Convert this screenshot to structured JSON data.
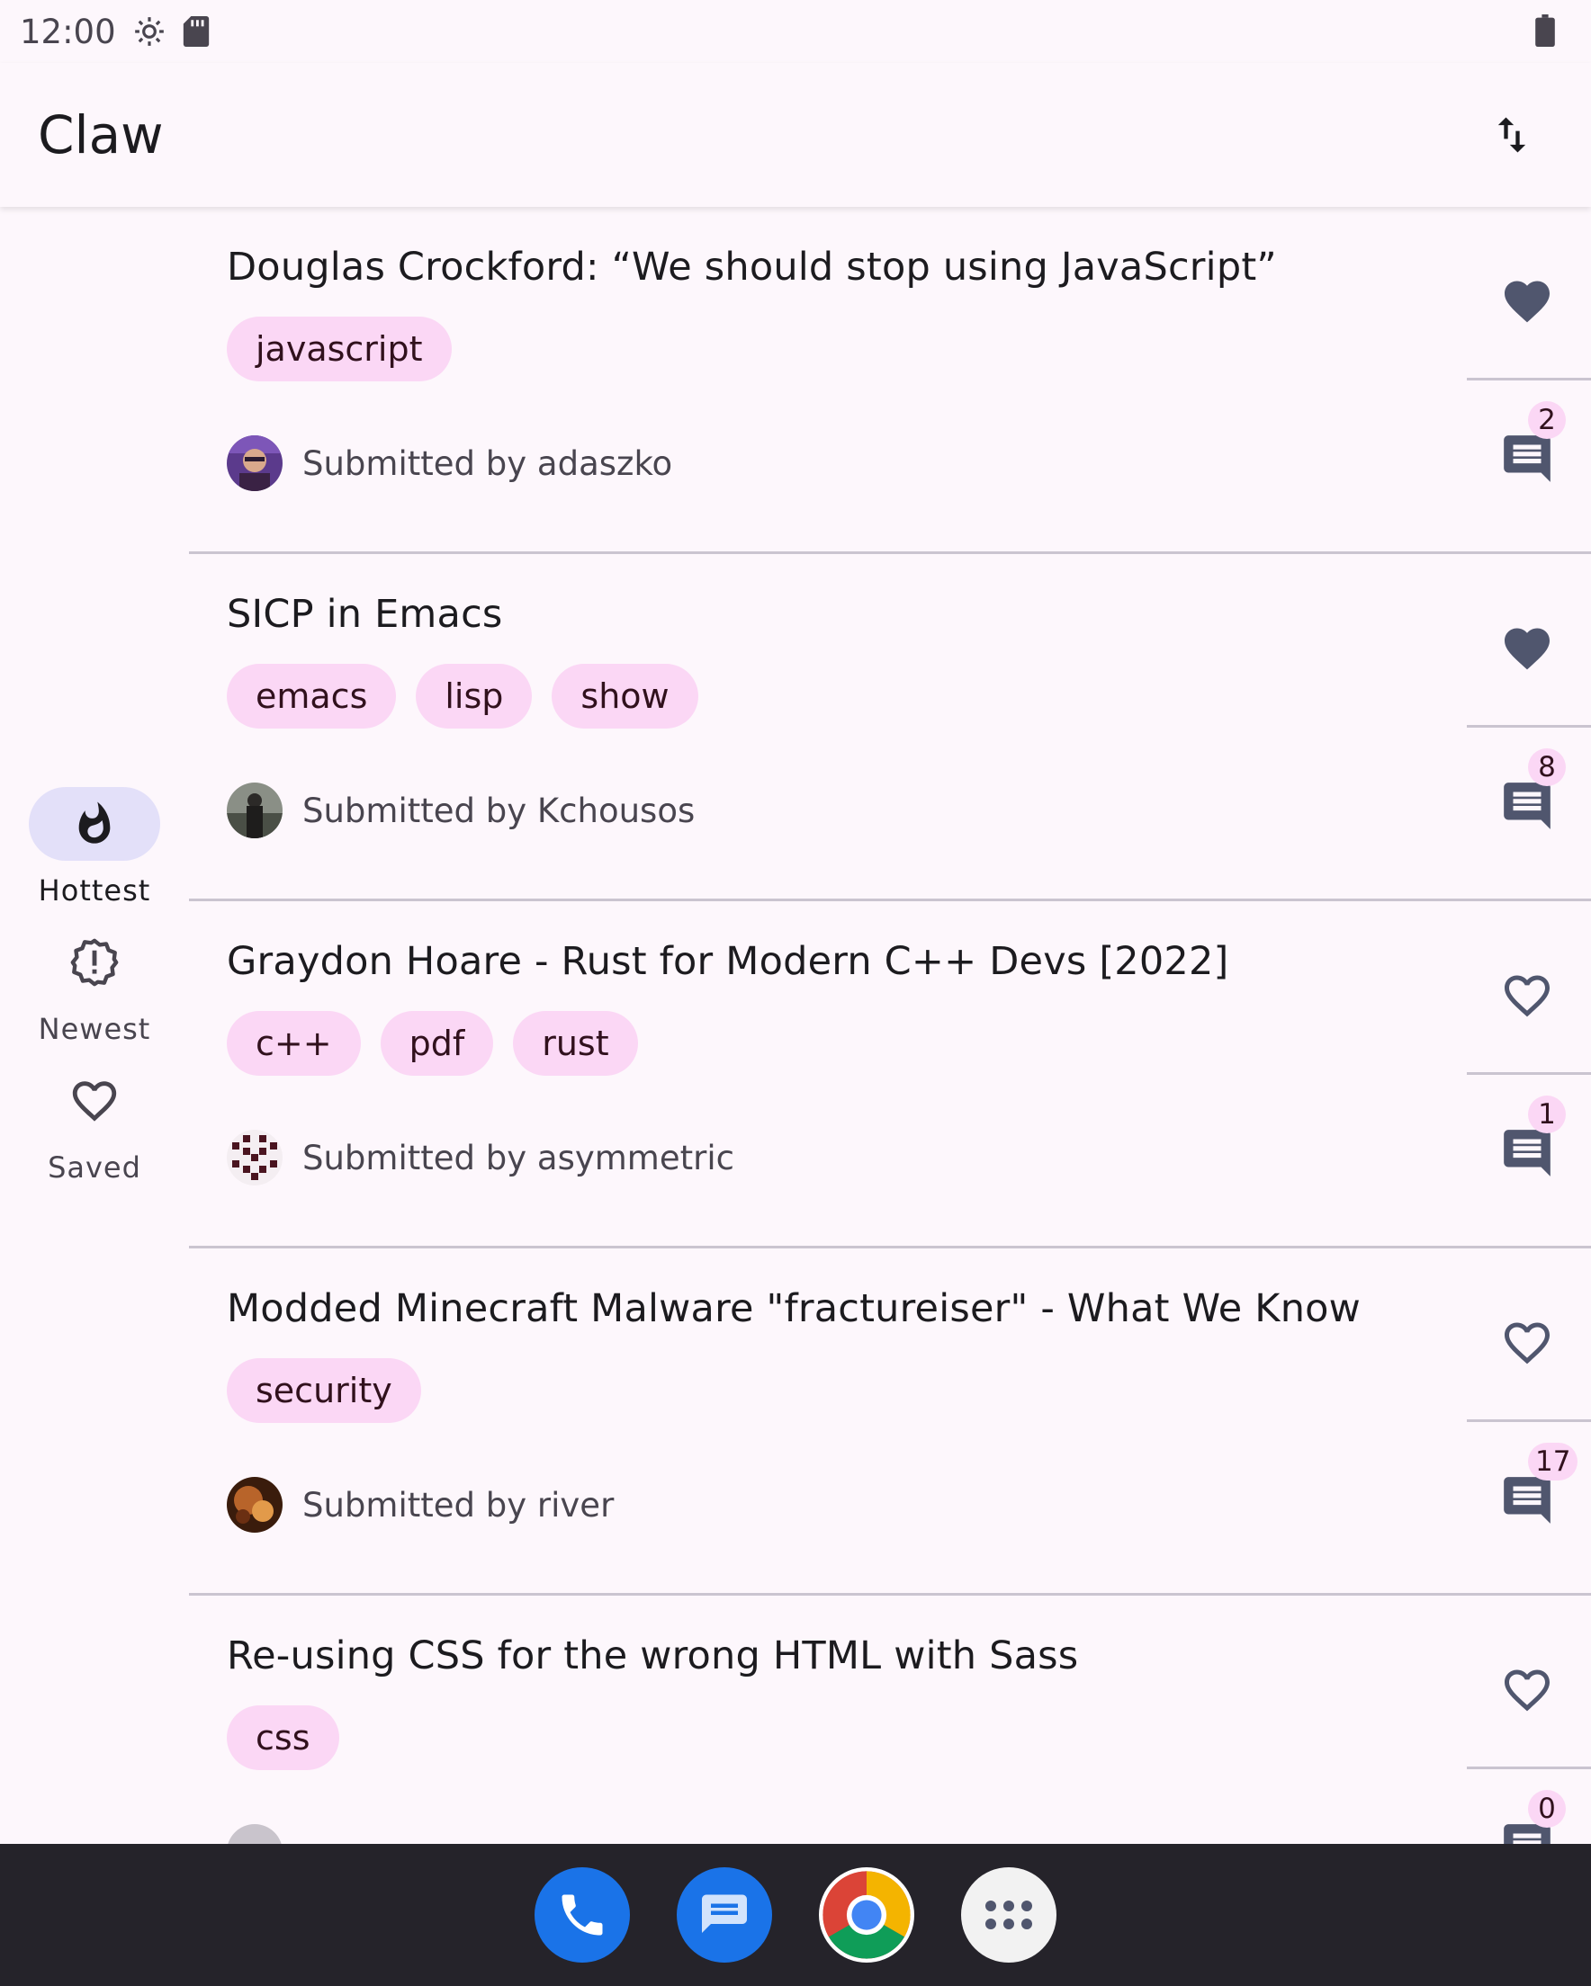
{
  "status_bar": {
    "time": "12:00",
    "icons": [
      "settings-icon",
      "sd-card-icon",
      "battery-icon"
    ]
  },
  "app_bar": {
    "title": "Claw",
    "sort_icon": "swap-vert-icon"
  },
  "nav_rail": {
    "items": [
      {
        "label": "Hottest",
        "icon": "flame-icon",
        "active": true
      },
      {
        "label": "Newest",
        "icon": "new-releases-icon",
        "active": false
      },
      {
        "label": "Saved",
        "icon": "heart-outline-icon",
        "active": false
      }
    ]
  },
  "stories": [
    {
      "title": "Douglas Crockford: “We should stop using JavaScript”",
      "tags": [
        "javascript"
      ],
      "submitted": "Submitted by adaszko",
      "saved": true,
      "comments": "2"
    },
    {
      "title": "SICP in Emacs",
      "tags": [
        "emacs",
        "lisp",
        "show"
      ],
      "submitted": "Submitted by Kchousos",
      "saved": true,
      "comments": "8"
    },
    {
      "title": "Graydon Hoare - Rust for Modern C++ Devs [2022]",
      "tags": [
        "c++",
        "pdf",
        "rust"
      ],
      "submitted": "Submitted by asymmetric",
      "saved": false,
      "comments": "1"
    },
    {
      "title": "Modded Minecraft Malware \"fractureiser\" - What We Know",
      "tags": [
        "security"
      ],
      "submitted": "Submitted by river",
      "saved": false,
      "comments": "17"
    },
    {
      "title": "Re-using CSS for the wrong HTML with Sass",
      "tags": [
        "css"
      ],
      "submitted": "",
      "saved": false,
      "comments": "0"
    }
  ],
  "dock": {
    "apps": [
      "phone-icon",
      "messages-icon",
      "chrome-icon",
      "app-drawer-icon"
    ]
  },
  "colors": {
    "background": "#fdf7fc",
    "tag_bg": "#fbd7f5",
    "rail_indicator": "#e3e0f9",
    "icon": "#50566e",
    "dock": "#25232a"
  }
}
